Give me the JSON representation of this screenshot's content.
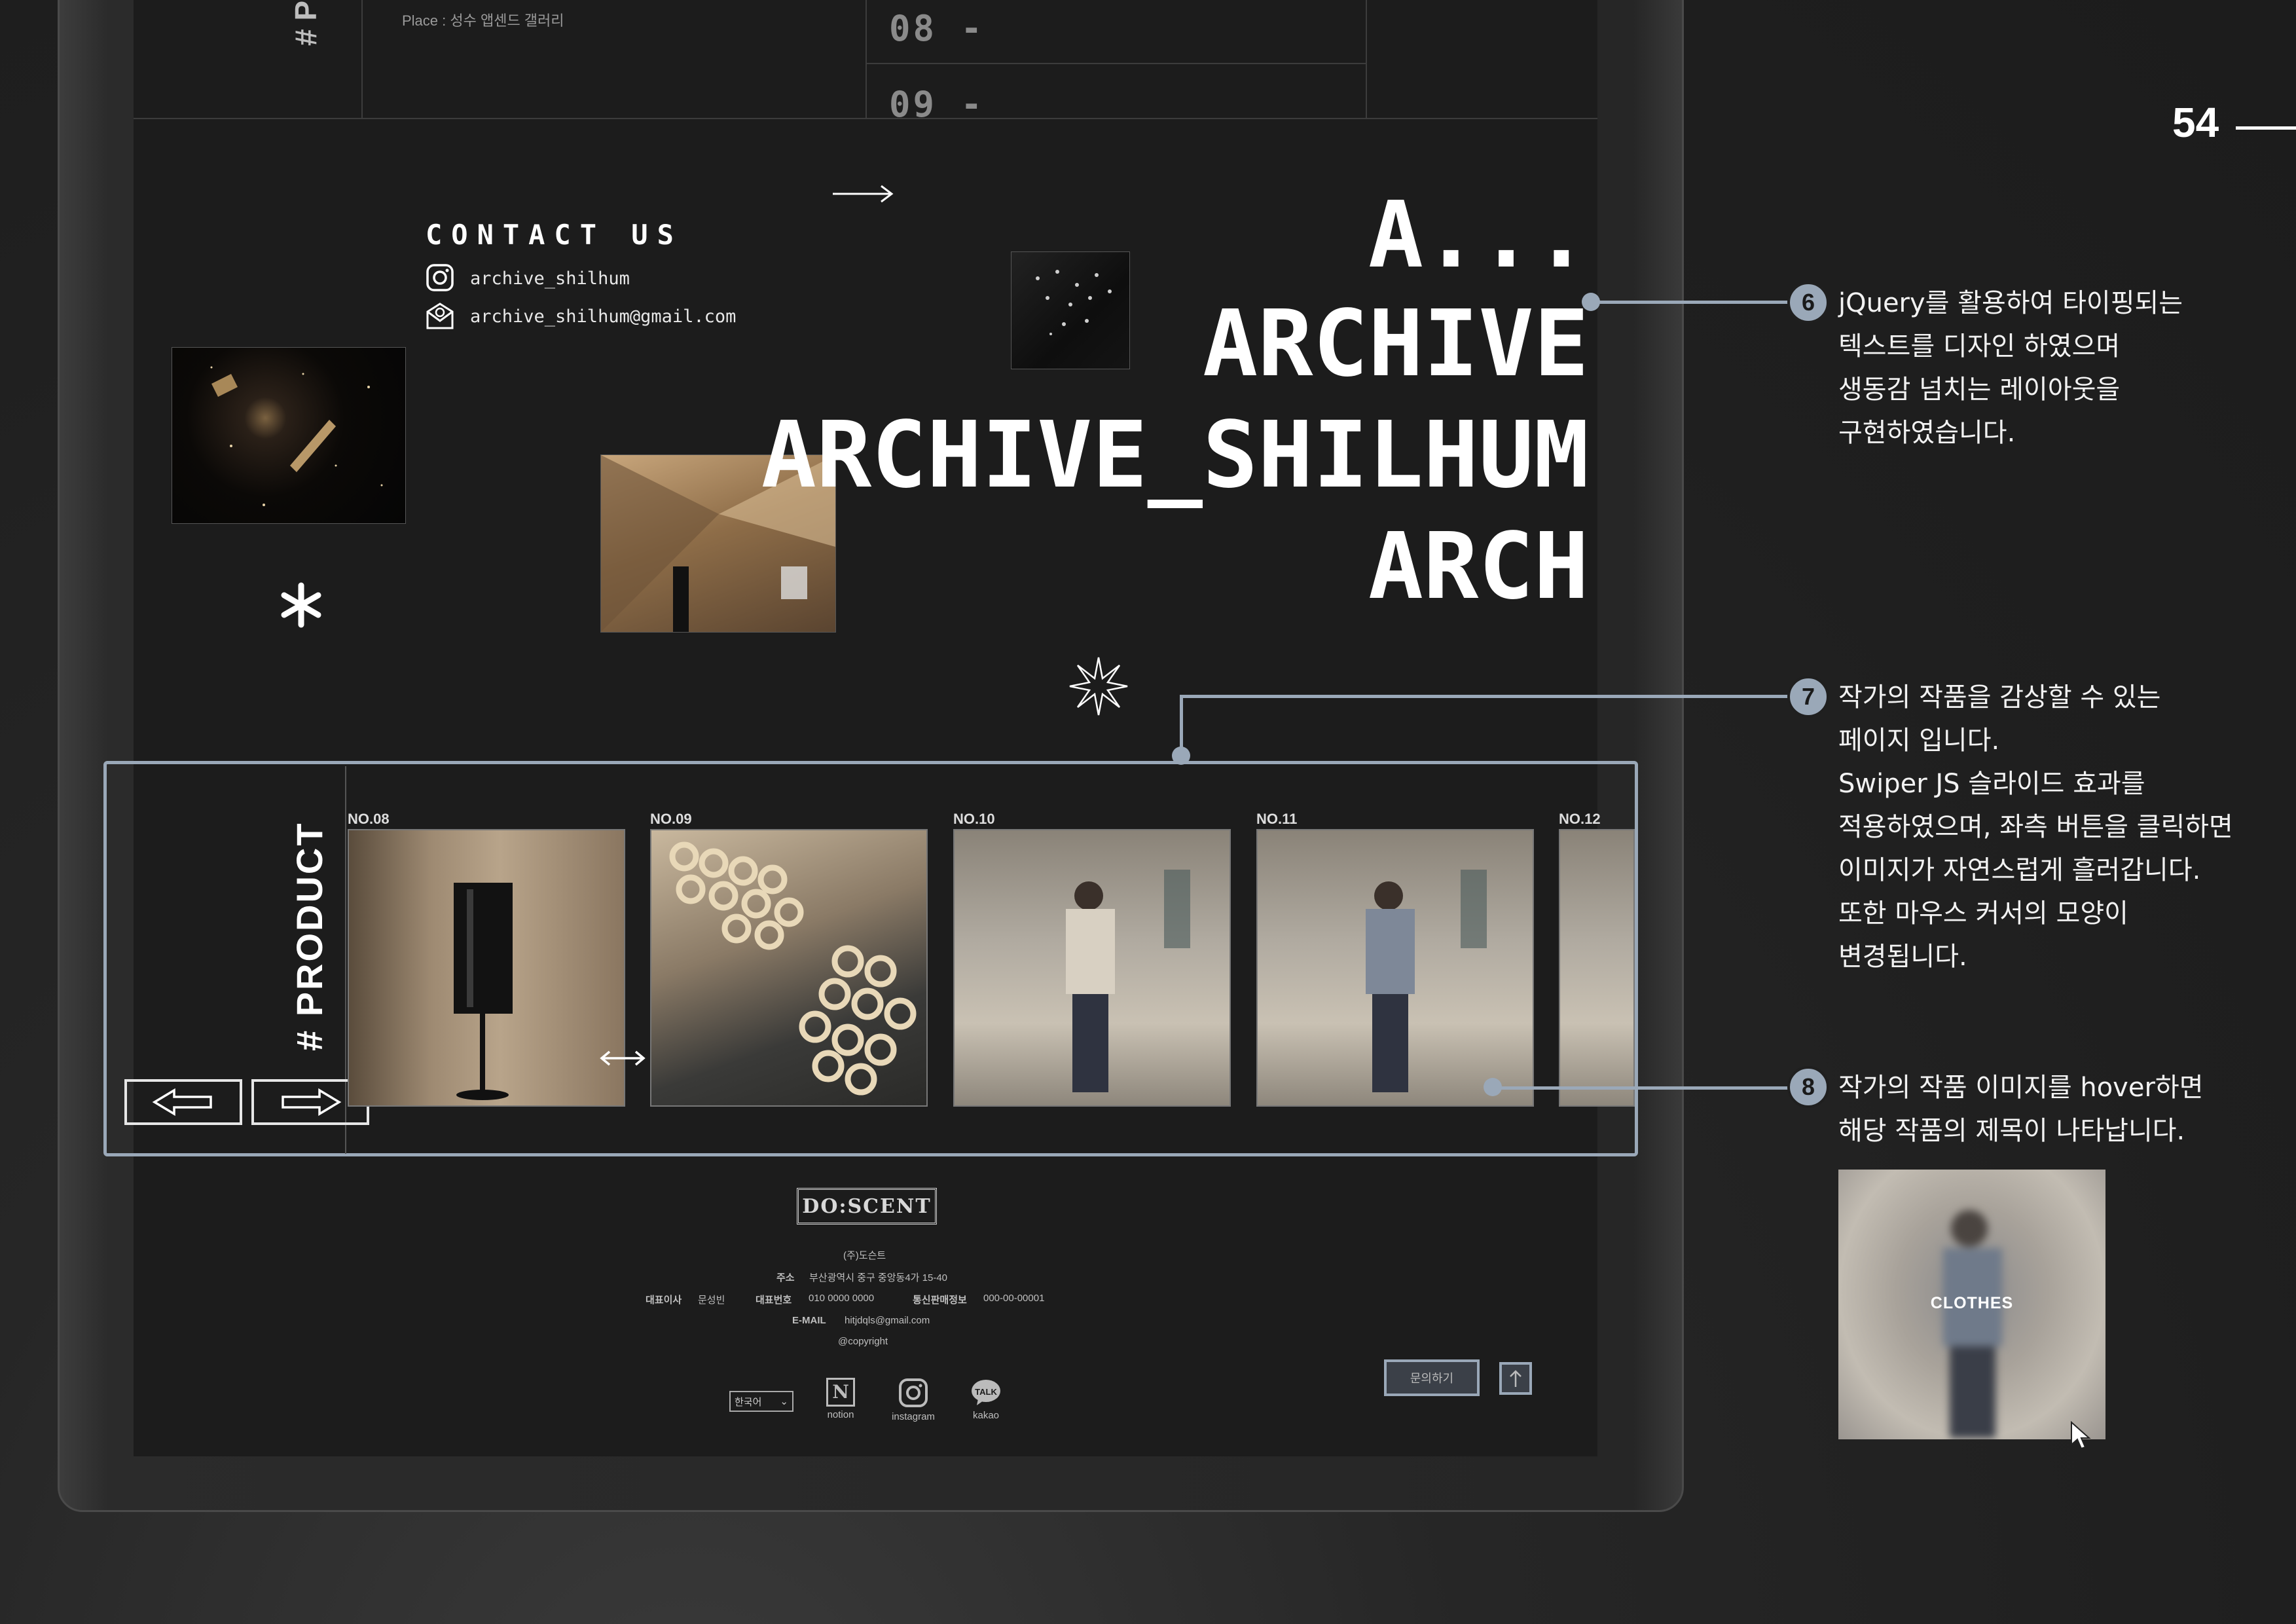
{
  "page_number": "54",
  "top": {
    "hash_label": "# PR",
    "place": "Place : 성수 앱센드 갤러리",
    "rows": [
      "08 -",
      "09 -"
    ]
  },
  "contact": {
    "title": "CONTACT US",
    "instagram": "archive_shilhum",
    "email": "archive_shilhum@gmail.com"
  },
  "hero": {
    "line1": "A...",
    "line2": "ARCHIVE",
    "line3": "ARCHIVE_SHILHUM",
    "line4": "ARCH"
  },
  "product": {
    "title": "# PRODUCT",
    "items": [
      {
        "label": "NO.08",
        "kind": "lamp"
      },
      {
        "label": "NO.09",
        "kind": "rings"
      },
      {
        "label": "NO.10",
        "kind": "figure"
      },
      {
        "label": "NO.11",
        "kind": "figure"
      },
      {
        "label": "NO.12",
        "kind": "figure"
      }
    ]
  },
  "footer": {
    "logo": "DO:SCENT",
    "company": "(주)도슨트",
    "address_label": "주소",
    "address": "부산광역시 중구 중앙동4가 15-40",
    "ceo_label": "대표이사",
    "ceo": "문성빈",
    "phone_label": "대표번호",
    "phone": "010 0000 0000",
    "biz_label": "통신판매정보",
    "biz": "000-00-00001",
    "email_label": "E-MAIL",
    "email": "hitjdqls@gmail.com",
    "copyright": "@copyright",
    "language": "한국어",
    "social": [
      {
        "label": "notion",
        "icon": "notion-icon"
      },
      {
        "label": "instagram",
        "icon": "instagram-icon"
      },
      {
        "label": "kakao",
        "icon": "kakao-icon"
      }
    ],
    "inquiry": "문의하기",
    "top_icon": "arrow-up-icon"
  },
  "notes": [
    {
      "num": "6",
      "lines": [
        "jQuery를 활용하여 타이핑되는",
        "텍스트를 디자인 하였으며",
        "생동감 넘치는 레이아웃을",
        "구현하였습니다."
      ]
    },
    {
      "num": "7",
      "lines": [
        "작가의 작품을 감상할 수 있는",
        "페이지 입니다.",
        "Swiper JS  슬라이드 효과를",
        "적용하였으며, 좌측 버튼을 클릭하면",
        "이미지가 자연스럽게 흘러갑니다.",
        "또한 마우스 커서의 모양이",
        "변경됩니다."
      ]
    },
    {
      "num": "8",
      "lines": [
        "작가의 작품 이미지를 hover하면",
        "해당 작품의 제목이 나타납니다."
      ]
    }
  ],
  "hover_preview": {
    "caption": "CLOTHES"
  },
  "colors": {
    "accent": "#9aa8b8",
    "screen": "#1c1c1c",
    "text": "#ffffff"
  }
}
